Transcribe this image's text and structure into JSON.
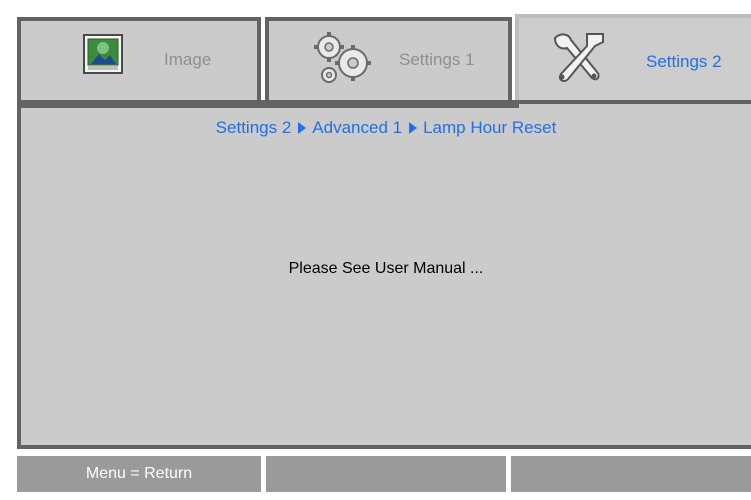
{
  "tabs": [
    {
      "label": "Image",
      "icon": "image-adjust-icon"
    },
    {
      "label": "Settings 1",
      "icon": "gears-icon"
    },
    {
      "label": "Settings 2",
      "icon": "tools-icon",
      "active": true
    }
  ],
  "breadcrumb": [
    "Settings 2",
    "Advanced 1",
    "Lamp Hour Reset"
  ],
  "message": "Please See User Manual ...",
  "footer": {
    "hint": "Menu = Return",
    "slot2": "",
    "slot3": ""
  },
  "colors": {
    "accent": "#1f6ff0",
    "panel": "#cbcbcb",
    "border": "#636363",
    "footer": "#9a9a9a",
    "inactive_text": "#8f8f8f"
  }
}
